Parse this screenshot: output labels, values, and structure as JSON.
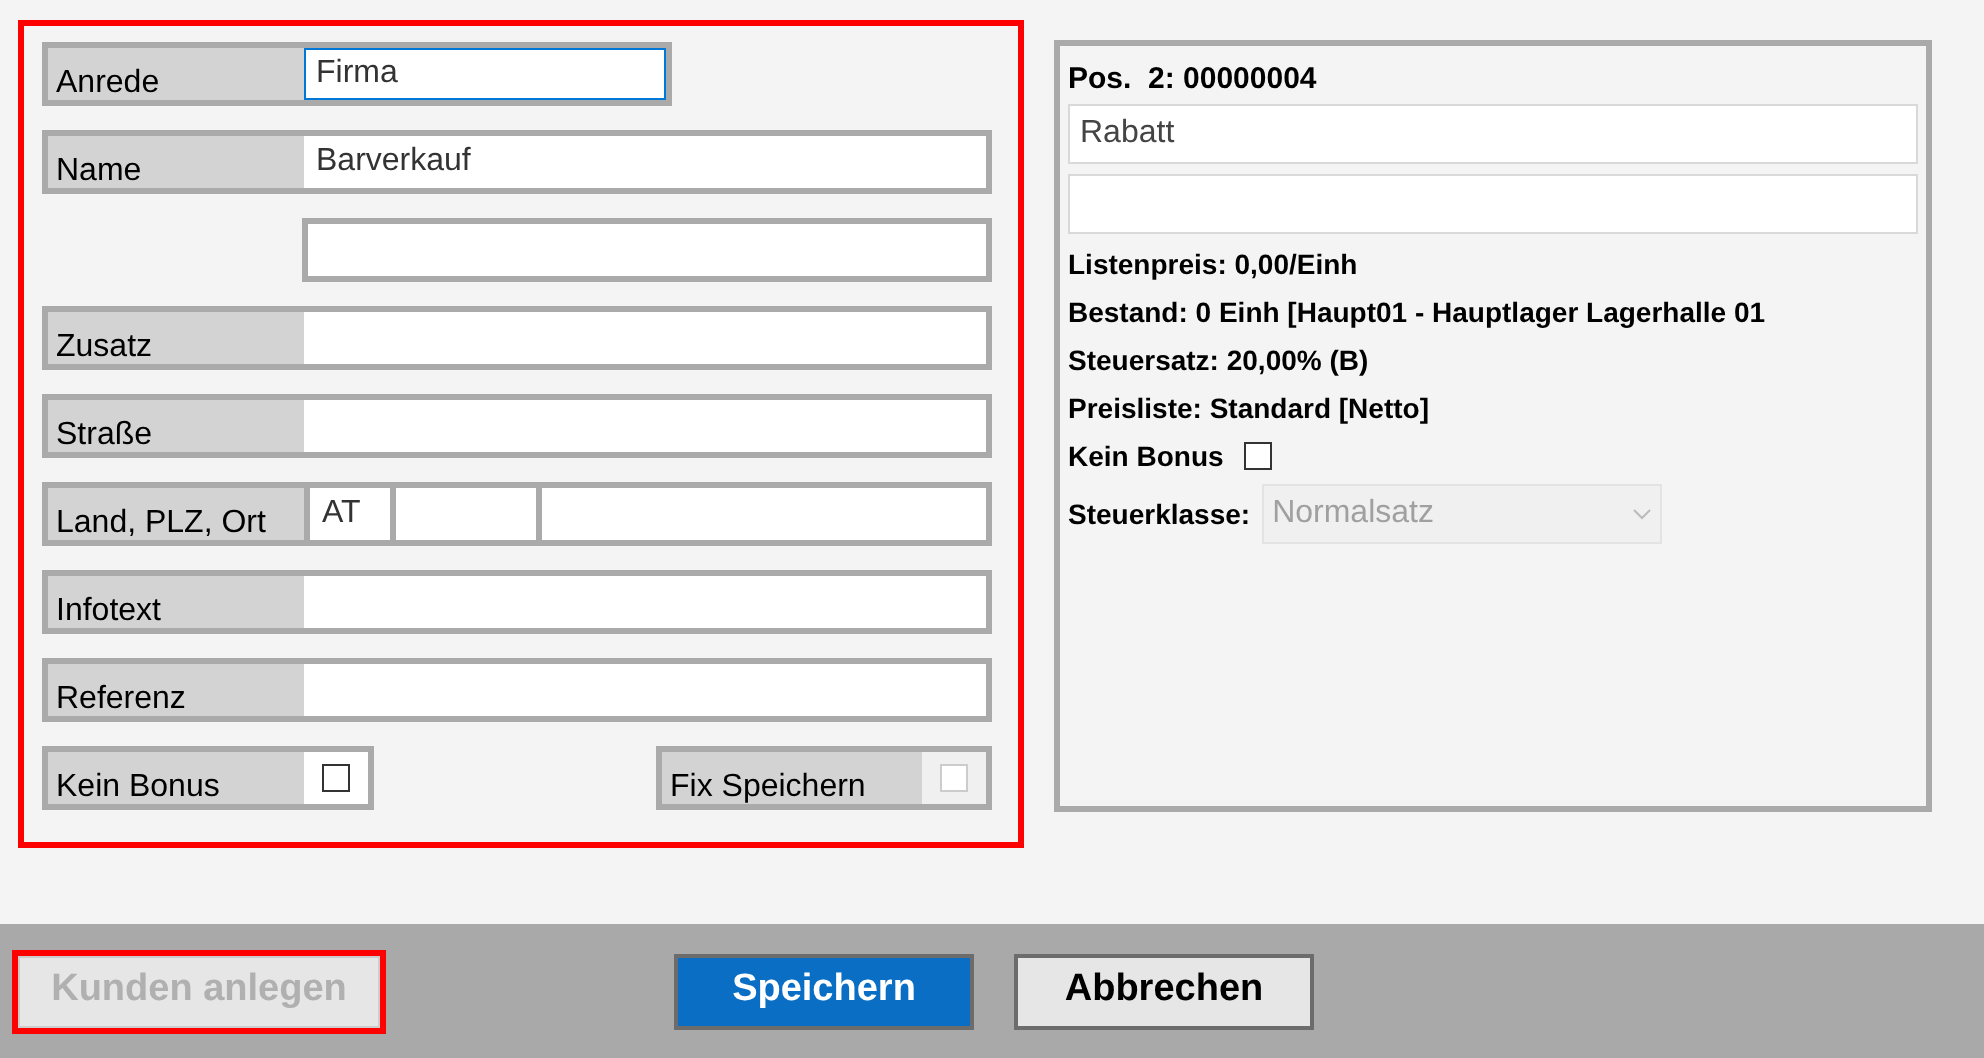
{
  "customer_form": {
    "highlighted": true,
    "fields": [
      {
        "kind": "short",
        "label": "Anrede",
        "value": "Firma",
        "focused": true
      },
      {
        "kind": "text",
        "label": "Name",
        "value": "Barverkauf",
        "focused": false
      },
      {
        "kind": "unlabeled",
        "focused": false
      },
      {
        "kind": "text",
        "label": "Zusatz",
        "focused": false
      },
      {
        "kind": "text",
        "label": "Straße",
        "focused": false
      },
      {
        "kind": "address",
        "label": "Land, PLZ, Ort",
        "value": "AT",
        "focused": false
      },
      {
        "kind": "text",
        "label": "Infotext",
        "focused": false
      },
      {
        "kind": "text",
        "label": "Referenz",
        "focused": false
      }
    ],
    "options": [
      {
        "label": "Kein Bonus",
        "checked": false,
        "disabled": false
      },
      {
        "label": "Fix Speichern",
        "checked": false,
        "disabled": true
      }
    ]
  },
  "position_panel": {
    "title": "Pos.  2: 00000004",
    "description": "Rabatt",
    "info_lines": [
      "Listenpreis: 0,00/Einh",
      "Bestand: 0 Einh [Haupt01 - Hauptlager Lagerhalle 01",
      "Steuersatz: 20,00% (B)",
      "Preisliste: Standard [Netto]"
    ],
    "kein_bonus": {
      "label": "Kein Bonus",
      "checked": false
    },
    "steuerklasse": {
      "label": "Steuerklasse:",
      "value": "Normalsatz",
      "disabled": true
    }
  },
  "footer": {
    "buttons": [
      {
        "label": "Kunden anlegen",
        "kind": "disabled",
        "highlighted": true
      },
      {
        "label": "Speichern",
        "kind": "primary",
        "highlighted": false
      },
      {
        "label": "Abbrechen",
        "kind": "secondary",
        "highlighted": false
      }
    ]
  }
}
